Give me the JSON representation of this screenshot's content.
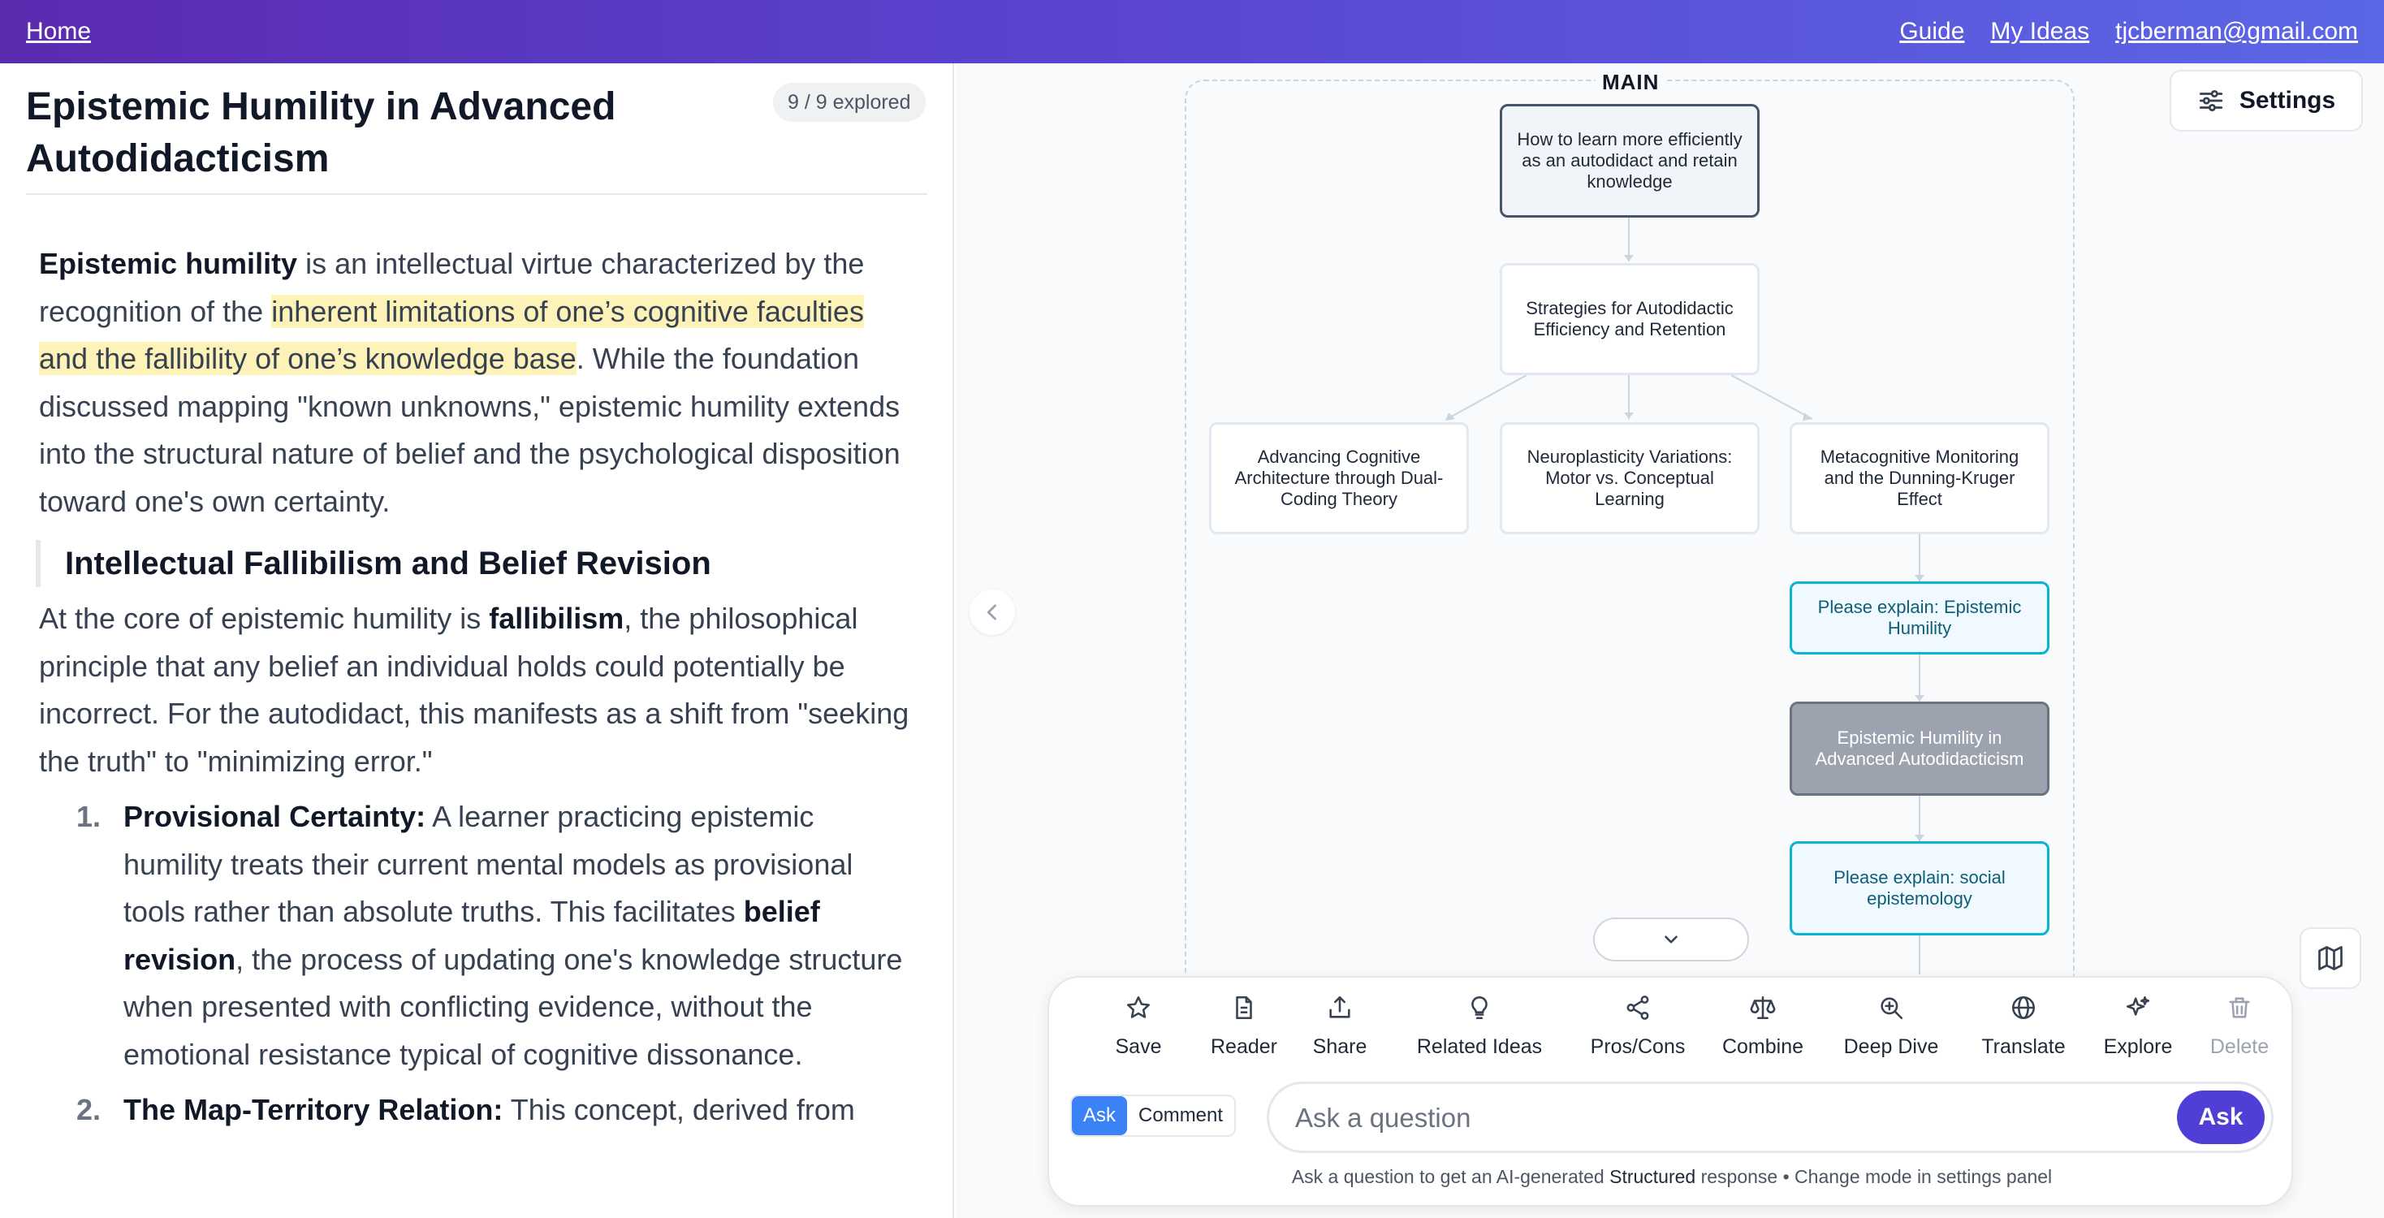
{
  "nav": {
    "home": "Home",
    "links": [
      "Guide",
      "My Ideas",
      "tjcberman@gmail.com"
    ]
  },
  "article": {
    "title": "Epistemic Humility in Advanced Autodidacticism",
    "progress": "9 / 9 explored",
    "p1": {
      "bold": "Epistemic humility",
      "t1": " is an intellectual virtue characterized by the recognition of the ",
      "highlight": "inherent limitations of one’s cognitive faculties and the fallibility of one’s knowledge base",
      "t2": ". While the foundation discussed mapping \"known unknowns,\" epistemic humility extends into the structural nature of belief and the psychological disposition toward one's own certainty."
    },
    "heading": "Intellectual Fallibilism and Belief Revision",
    "p2": {
      "t1": "At the core of epistemic humility is ",
      "bold": "fallibilism",
      "t2": ", the philosophical principle that any belief an individual holds could potentially be incorrect. For the autodidact, this manifests as a shift from \"seeking the truth\" to \"minimizing error.\""
    },
    "list": [
      {
        "num": "1.",
        "bold": "Provisional Certainty:",
        "t1": " A learner practicing epistemic humility treats their current mental models as provisional tools rather than absolute truths. This facilitates ",
        "bold2": "belief revision",
        "t2": ", the process of updating one's knowledge structure when presented with conflicting evidence, without the emotional resistance typical of cognitive dissonance."
      },
      {
        "num": "2.",
        "bold": "The Map-Territory Relation:",
        "t1": " This concept, derived from",
        "bold2": "",
        "t2": ""
      }
    ]
  },
  "canvas": {
    "group_label": "MAIN",
    "nodes": {
      "root": "How to learn more efficiently as an autodidact and retain knowledge",
      "strategies": "Strategies for Autodidactic Efficiency and Retention",
      "cognitive": "Advancing Cognitive Architecture through Dual-Coding Theory",
      "neuro": "Neuroplasticity Variations: Motor vs. Conceptual Learning",
      "meta": "Metacognitive Monitoring and the Dunning-Kruger Effect",
      "ask_epistemic": "Please explain: Epistemic Humility",
      "current": "Epistemic Humility in Advanced Autodidacticism",
      "ask_social": "Please explain: social epistemology"
    }
  },
  "settings": {
    "label": "Settings"
  },
  "panel": {
    "tools": [
      "Save",
      "Reader",
      "Share",
      "Related Ideas",
      "Pros/Cons",
      "Combine",
      "Deep Dive",
      "Translate",
      "Explore",
      "Delete"
    ],
    "modes": [
      "Ask",
      "Comment"
    ],
    "placeholder": "Ask a question",
    "ask_button": "Ask",
    "hint_pre": "Ask a question to get an AI-generated ",
    "hint_bold": "Structured",
    "hint_post": " response • Change mode in settings panel"
  },
  "colors": {
    "nav_gradient_start": "#5b2bb0",
    "nav_gradient_end": "#5b67e6",
    "highlight": "#fdf3b8",
    "ask_node_border": "#06b6d4",
    "ask_button": "#4f3fd7",
    "active_mode": "#3b82f6"
  }
}
